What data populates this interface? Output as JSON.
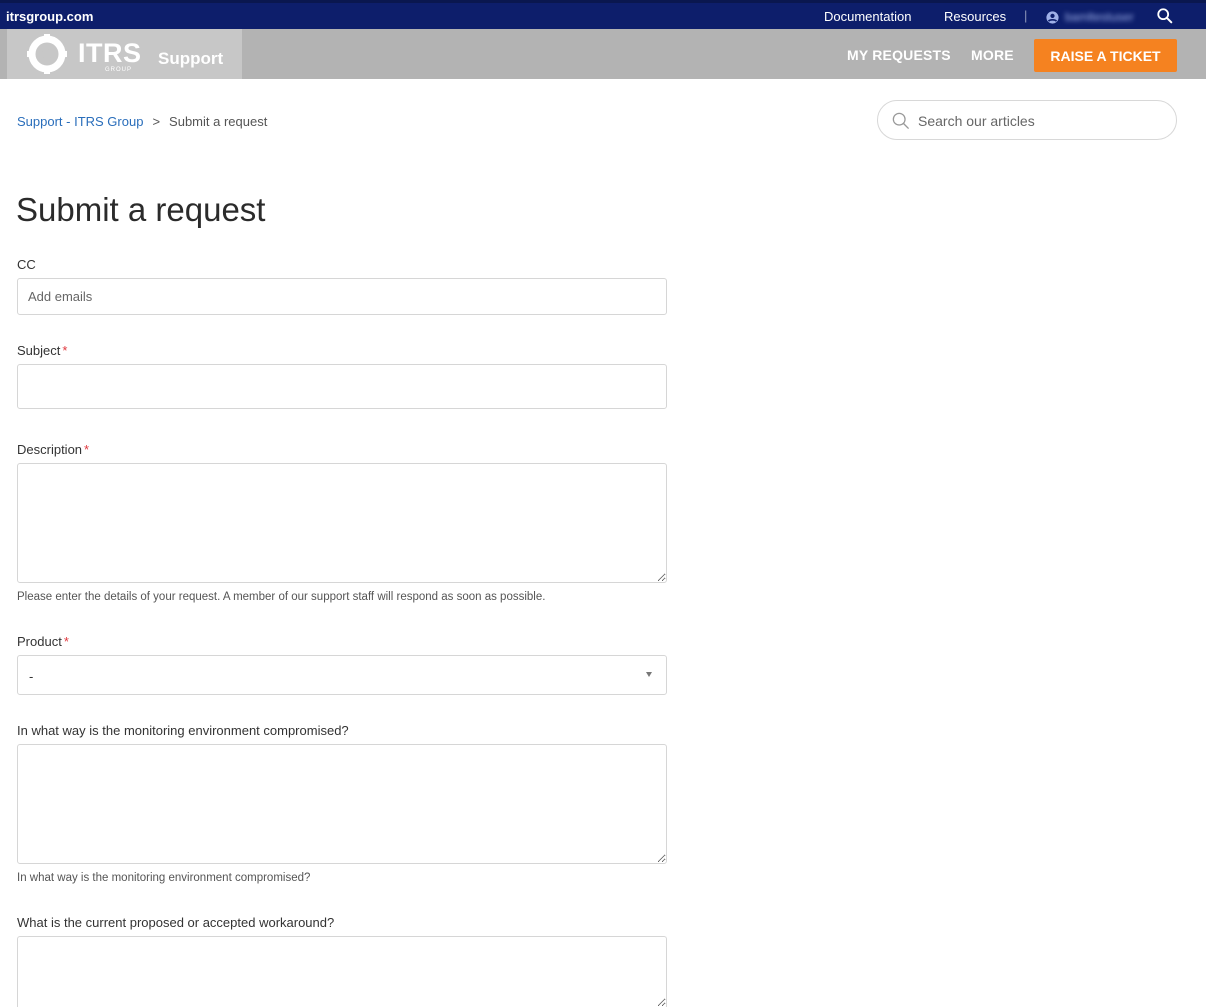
{
  "topbar": {
    "domain": "itrsgroup.com",
    "links": [
      "Documentation",
      "Resources"
    ],
    "separator": "|",
    "username": "bamltestuser"
  },
  "nav": {
    "brand_text": "ITRS",
    "brand_sub": "GROUP",
    "brand_support": "Support",
    "my_requests": "MY REQUESTS",
    "more": "MORE",
    "raise_ticket": "RAISE A TICKET"
  },
  "breadcrumb": {
    "home": "Support - ITRS Group",
    "separator": ">",
    "current": "Submit a request"
  },
  "search": {
    "placeholder": "Search our articles"
  },
  "form": {
    "title": "Submit a request",
    "cc_label": "CC",
    "cc_placeholder": "Add emails",
    "subject_label": "Subject",
    "required_mark": "*",
    "description_label": "Description",
    "description_hint": "Please enter the details of your request. A member of our support staff will respond as soon as possible.",
    "product_label": "Product",
    "product_value": "-",
    "compromised_label": "In what way is the monitoring environment compromised?",
    "compromised_hint": "In what way is the monitoring environment compromised?",
    "workaround_label": "What is the current proposed or accepted workaround?"
  },
  "colors": {
    "topbar": "#0d1e6b",
    "navbar": "#b3b3b3",
    "accent": "#f58220",
    "link": "#2a6ebb",
    "required": "#e0383e"
  }
}
